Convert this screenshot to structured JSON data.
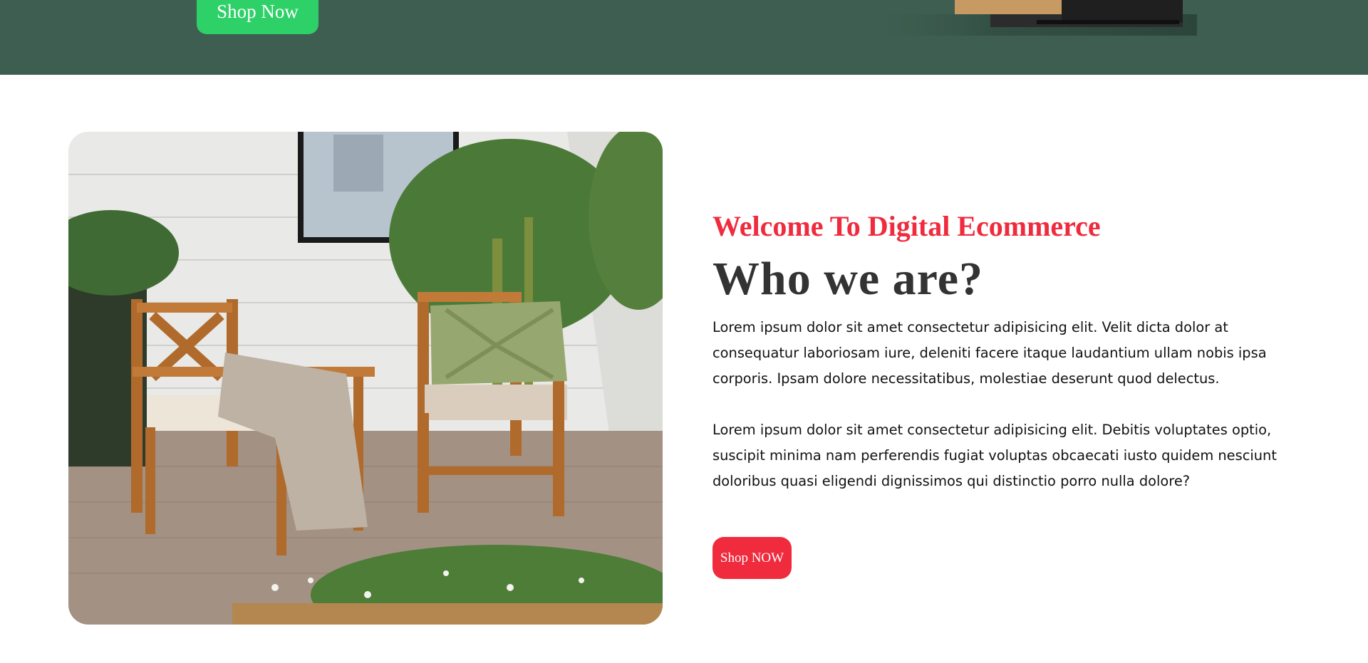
{
  "hero": {
    "button_label": "Shop Now"
  },
  "about": {
    "subtitle": "Welcome To Digital Ecommerce",
    "title": "Who we are?",
    "paragraphs": [
      "Lorem ipsum dolor sit amet consectetur adipisicing elit. Velit dicta dolor at consequatur laboriosam iure, deleniti facere itaque laudantium ullam nobis ipsa corporis. Ipsam dolore necessitatibus, molestiae deserunt quod delectus.",
      "Lorem ipsum dolor sit amet consectetur adipisicing elit. Debitis voluptates optio, suscipit minima nam perferendis fugiat voluptas obcaecati iusto quidem nesciunt doloribus quasi eligendi dignissimos qui distinctio porro nulla dolore?"
    ],
    "button_label": "Shop NOW"
  },
  "colors": {
    "hero_background": "#3d5e50",
    "hero_button": "#2ed068",
    "accent": "#ef2b3d",
    "heading": "#333333"
  }
}
